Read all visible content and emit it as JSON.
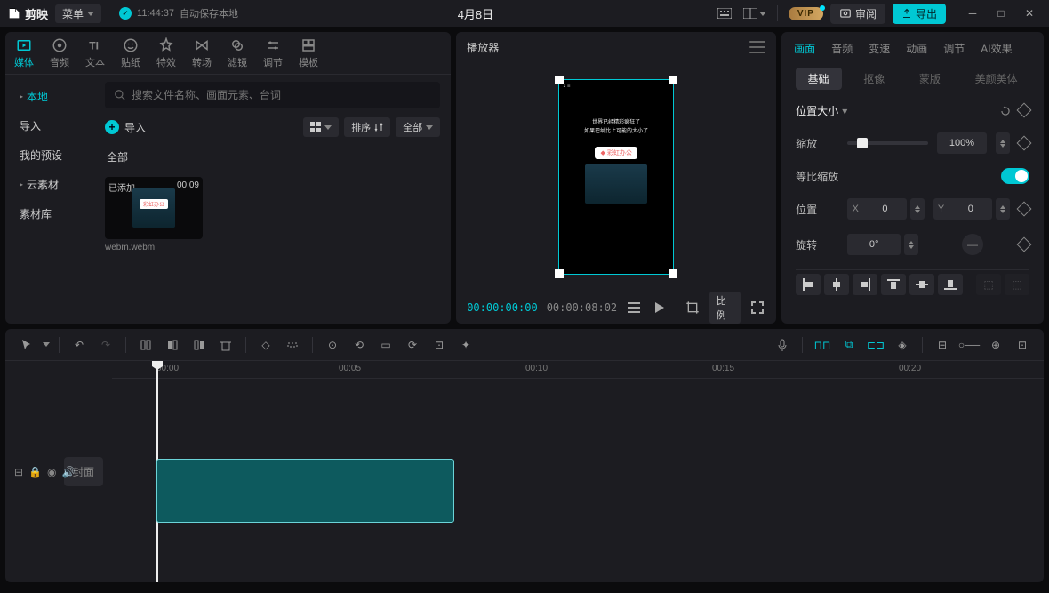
{
  "app": {
    "name": "剪映",
    "menu": "菜单"
  },
  "autosave": {
    "time": "11:44:37",
    "text": "自动保存本地"
  },
  "title": "4月8日",
  "actions": {
    "review": "审阅",
    "export": "导出",
    "vip": "VIP"
  },
  "tabs": [
    "媒体",
    "音频",
    "文本",
    "贴纸",
    "特效",
    "转场",
    "滤镜",
    "调节",
    "模板"
  ],
  "sidebar": {
    "items": [
      "本地",
      "导入",
      "我的预设",
      "云素材",
      "素材库"
    ]
  },
  "search": {
    "placeholder": "搜索文件名称、画面元素、台词"
  },
  "import": {
    "label": "导入"
  },
  "tools": {
    "sort": "排序",
    "all": "全部"
  },
  "section_all": "全部",
  "clip": {
    "added": "已添加",
    "duration": "00:09",
    "name": "webm.webm",
    "brand": "彩虹办公"
  },
  "preview": {
    "title": "播放器",
    "tc_current": "00:00:00:00",
    "tc_total": "00:00:08:02",
    "ratio": "比例",
    "overlay_line1": "世界已经精彩疯狂了",
    "overlay_line2": "如果巴纳比上可能的大小了",
    "overlay_brand": "彩虹办公"
  },
  "inspector": {
    "tabs": [
      "画面",
      "音频",
      "变速",
      "动画",
      "调节",
      "AI效果"
    ],
    "subtabs": [
      "基础",
      "抠像",
      "蒙版",
      "美颜美体"
    ],
    "section": "位置大小",
    "scale": {
      "label": "缩放",
      "value": "100%"
    },
    "ratio_scale": "等比缩放",
    "position": {
      "label": "位置",
      "x_label": "X",
      "x": "0",
      "y_label": "Y",
      "y": "0"
    },
    "rotation": {
      "label": "旋转",
      "value": "0°"
    }
  },
  "timeline": {
    "cover": "封面",
    "ticks": [
      "00:00",
      "00:05",
      "00:10",
      "00:15",
      "00:20"
    ]
  }
}
